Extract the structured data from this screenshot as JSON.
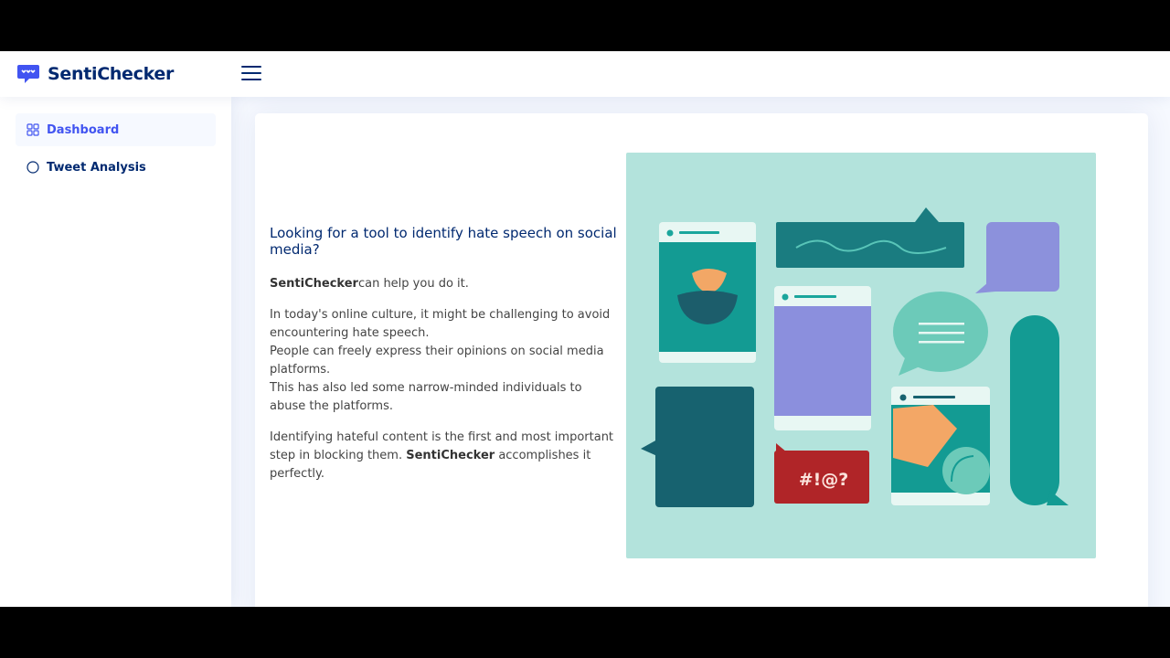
{
  "app": {
    "title": "SentiChecker",
    "logo_icon": "chat-bubble-logo-icon",
    "brand_color": "#012970",
    "accent_color": "#4154f1"
  },
  "header": {
    "menu_icon": "hamburger-menu-icon"
  },
  "sidebar": {
    "items": [
      {
        "label": "Dashboard",
        "icon": "grid-icon",
        "active": true
      },
      {
        "label": "Tweet Analysis",
        "icon": "circle-icon",
        "active": false
      }
    ]
  },
  "main": {
    "heading": "Looking for a tool to identify hate speech on social media?",
    "intro_brand": "SentiChecker",
    "intro_text": "can help you do it.",
    "paragraph2_line1": "In today's online culture, it might be challenging to avoid encountering hate speech.",
    "paragraph2_line2": "People can freely express their opinions on social media platforms.",
    "paragraph2_line3": "This has also led some narrow-minded individuals to abuse the platforms.",
    "paragraph3_before": "Identifying hateful content is the first and most important step in blocking them. ",
    "paragraph3_brand": "SentiChecker",
    "paragraph3_after": " accomplishes it perfectly.",
    "illustration": {
      "symbols_text": "#!@?"
    }
  }
}
